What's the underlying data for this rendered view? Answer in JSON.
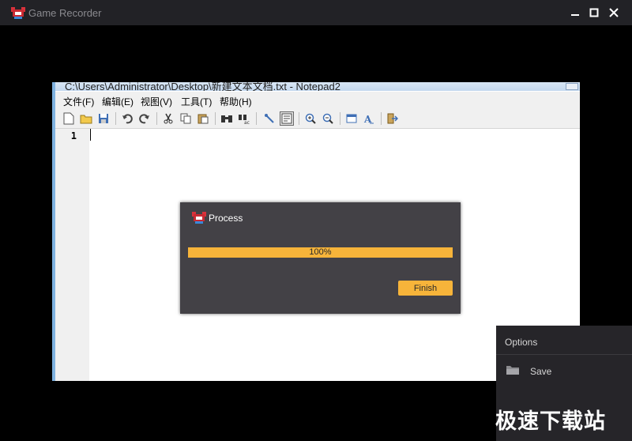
{
  "window": {
    "title": "Game Recorder",
    "controls": {
      "minimize": "minimize-icon",
      "maximize": "maximize-icon",
      "close": "close-icon"
    }
  },
  "notepad": {
    "title": "C:\\Users\\Administrator\\Desktop\\新建文本文档.txt - Notepad2",
    "menu": [
      "文件(F)",
      "编辑(E)",
      "视图(V)",
      "工具(T)",
      "帮助(H)"
    ],
    "toolbar_icons": [
      "new-file-icon",
      "open-folder-icon",
      "save-icon",
      "undo-icon",
      "redo-icon",
      "cut-icon",
      "copy-icon",
      "paste-icon",
      "find-icon",
      "replace-icon",
      "word-wrap-icon",
      "scheme-icon",
      "zoom-in-icon",
      "zoom-out-icon",
      "view-icon",
      "font-icon",
      "exit-icon"
    ],
    "line_number": "1"
  },
  "process_dialog": {
    "title": "Process",
    "progress": 1.0,
    "progress_text": "100%",
    "finish_label": "Finish"
  },
  "options_panel": {
    "title": "Options",
    "save_label": "Save"
  },
  "watermark": "极速下载站",
  "colors": {
    "accent": "#f7b43a",
    "titlebar": "#222226",
    "dialog": "#434146",
    "panel": "#262529"
  }
}
